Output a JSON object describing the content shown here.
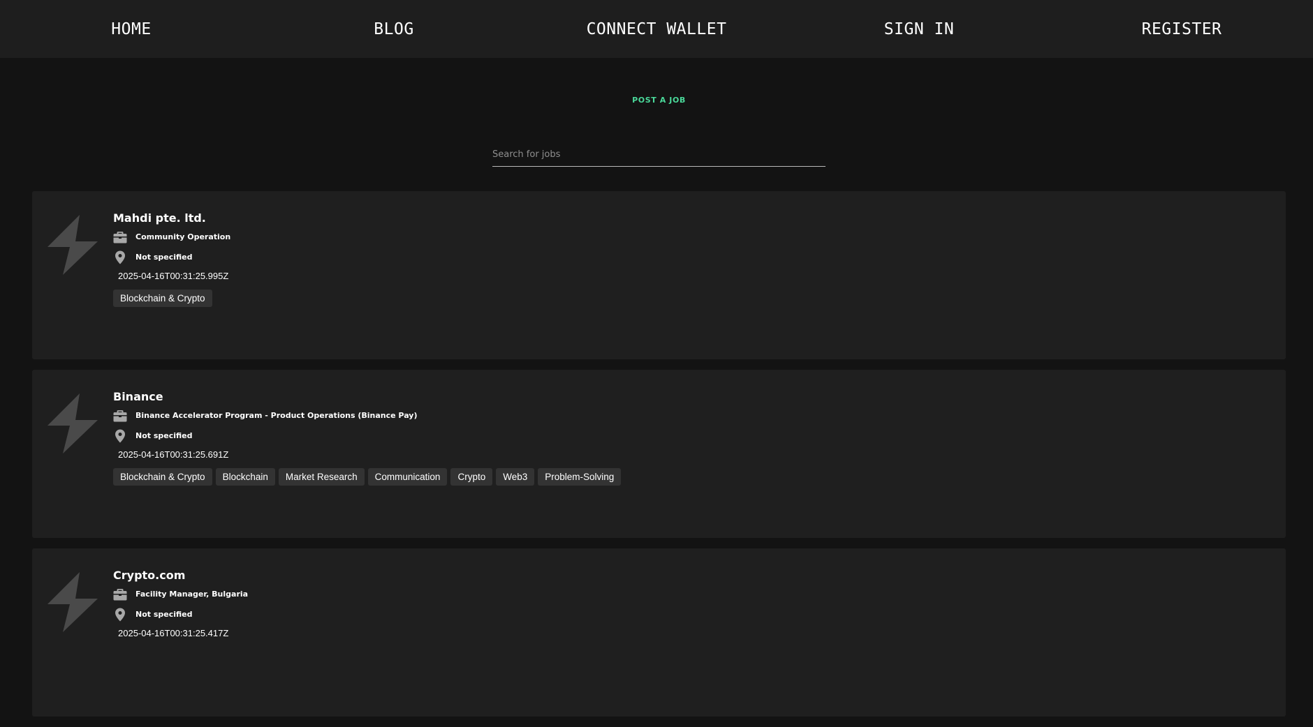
{
  "nav": {
    "items": [
      {
        "label": "HOME"
      },
      {
        "label": "BLOG"
      },
      {
        "label": "CONNECT WALLET"
      },
      {
        "label": "SIGN IN"
      },
      {
        "label": "REGISTER"
      }
    ]
  },
  "post_job_label": "POST A JOB",
  "search": {
    "placeholder": "Search for jobs",
    "value": ""
  },
  "icons": {
    "logo": "lightning-bolt-icon",
    "role": "briefcase-icon",
    "location": "location-pin-icon"
  },
  "colors": {
    "accent": "#4ad99a",
    "background": "#131313",
    "card": "#1f1f1f",
    "tag": "#333333"
  },
  "jobs": [
    {
      "company": "Mahdi pte. ltd.",
      "role": "Community Operation",
      "location": "Not specified",
      "posted": "2025-04-16T00:31:25.995Z",
      "tags": [
        "Blockchain & Crypto"
      ]
    },
    {
      "company": "Binance",
      "role": "Binance Accelerator Program - Product Operations (Binance Pay)",
      "location": "Not specified",
      "posted": "2025-04-16T00:31:25.691Z",
      "tags": [
        "Blockchain & Crypto",
        "Blockchain",
        "Market Research",
        "Communication",
        "Crypto",
        "Web3",
        "Problem-Solving"
      ]
    },
    {
      "company": "Crypto.com",
      "role": "Facility Manager, Bulgaria",
      "location": "Not specified",
      "posted": "2025-04-16T00:31:25.417Z",
      "tags": []
    }
  ]
}
